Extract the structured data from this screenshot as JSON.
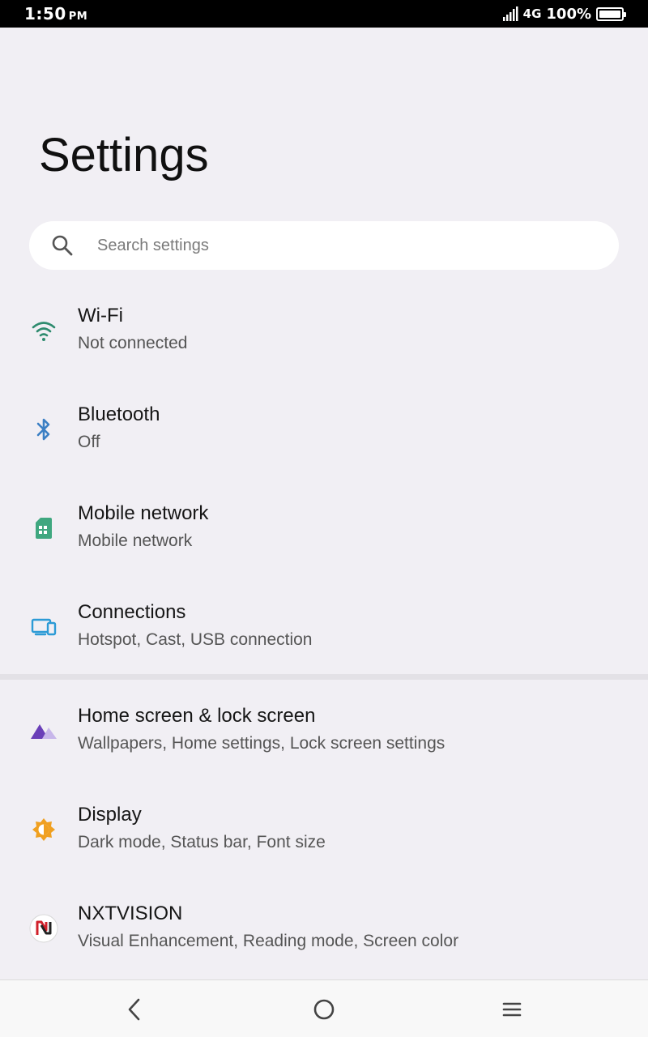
{
  "status_bar": {
    "time": "1:50",
    "ampm": "PM",
    "network": "4G",
    "battery": "100%"
  },
  "page": {
    "title": "Settings"
  },
  "search": {
    "placeholder": "Search settings",
    "icon": "search-icon"
  },
  "settings_items": [
    {
      "title": "Wi-Fi",
      "subtitle": "Not connected",
      "icon": "wifi-icon",
      "color": "#2e8b6e"
    },
    {
      "title": "Bluetooth",
      "subtitle": "Off",
      "icon": "bluetooth-icon",
      "color": "#3b7fc4"
    },
    {
      "title": "Mobile network",
      "subtitle": "Mobile network",
      "icon": "sim-card-icon",
      "color": "#3fa77f"
    },
    {
      "title": "Connections",
      "subtitle": "Hotspot, Cast, USB connection",
      "icon": "devices-icon",
      "color": "#2c9bd6"
    },
    {
      "title": "Home screen & lock screen",
      "subtitle": "Wallpapers, Home settings, Lock screen settings",
      "icon": "mountain-icon",
      "color": "#7a4fc0"
    },
    {
      "title": "Display",
      "subtitle": "Dark mode, Status bar, Font size",
      "icon": "brightness-icon",
      "color": "#f0a020"
    },
    {
      "title": "NXTVISION",
      "subtitle": "Visual Enhancement, Reading mode, Screen color",
      "icon": "nxtvision-icon",
      "color": "#d0202a"
    }
  ],
  "nav_bar": {
    "back": "back-icon",
    "home": "home-icon",
    "menu": "menu-icon"
  }
}
